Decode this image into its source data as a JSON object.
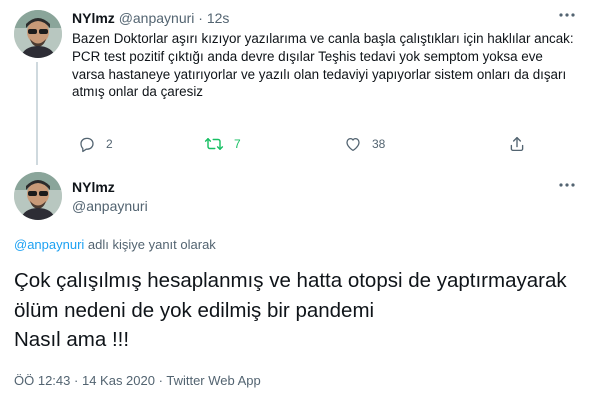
{
  "parent_tweet": {
    "display_name": "NYlmz",
    "handle": "@anpaynuri",
    "separator": "·",
    "time": "12s",
    "text": "Bazen Doktorlar aşırı kızıyor yazılarıma ve canla başla çalıştıkları için haklılar ancak:\nPCR test pozitif çıktığı anda devre dışılar Teşhis tedavi yok semptom yoksa eve varsa hastaneye yatırıyorlar ve yazılı olan tedaviyi yapıyorlar sistem onları da dışarı atmış onlar da çaresiz",
    "actions": {
      "reply_count": "2",
      "retweet_count": "7",
      "like_count": "38"
    },
    "colors": {
      "retweet_active": "#17bf63",
      "muted": "#536471"
    }
  },
  "main_tweet": {
    "display_name": "NYlmz",
    "handle": "@anpaynuri",
    "reply_to": {
      "mention": "@anpaynuri",
      "suffix": " adlı kişiye yanıt olarak"
    },
    "text": "Çok çalışılmış hesaplanmış ve hatta otopsi de yaptırmayarak ölüm nedeni de yok edilmiş bir pandemi\nNasıl ama !!!",
    "time": "ÖÖ 12:43",
    "date": "14 Kas 2020",
    "source": "Twitter Web App",
    "separator": "·",
    "colors": {
      "mention": "#1da1f2"
    }
  },
  "icons": [
    "more-icon",
    "reply-icon",
    "retweet-icon",
    "like-icon",
    "share-icon"
  ]
}
